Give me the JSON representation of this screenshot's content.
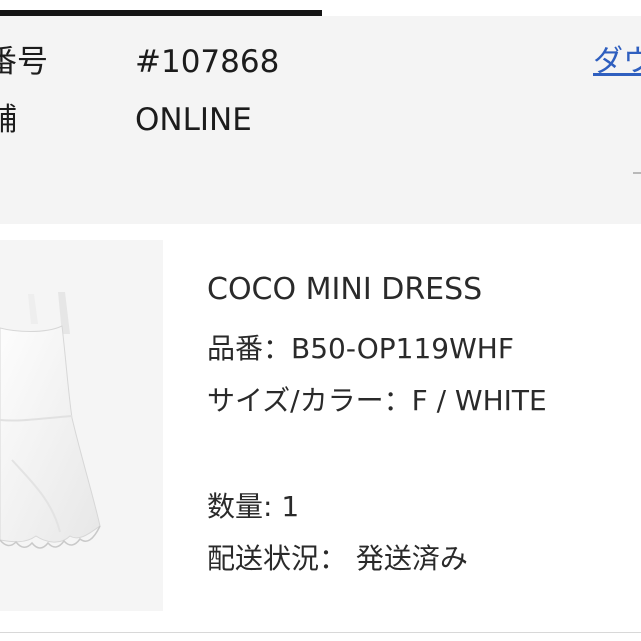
{
  "order": {
    "number_label": "番号",
    "number_value": "#107868",
    "store_label": "舗",
    "store_value": "ONLINE",
    "download_text": "ダウ"
  },
  "product": {
    "name": "COCO MINI DRESS",
    "sku_line": "品番：B50-OP119WHF",
    "size_color_line": "サイズ/カラー：F / WHITE",
    "quantity_line": "数量: 1",
    "shipping_line": "配送状況：  発送済み"
  },
  "colors": {
    "link": "#2f5fbf",
    "panel_bg": "#f4f4f4",
    "text": "#222222"
  }
}
